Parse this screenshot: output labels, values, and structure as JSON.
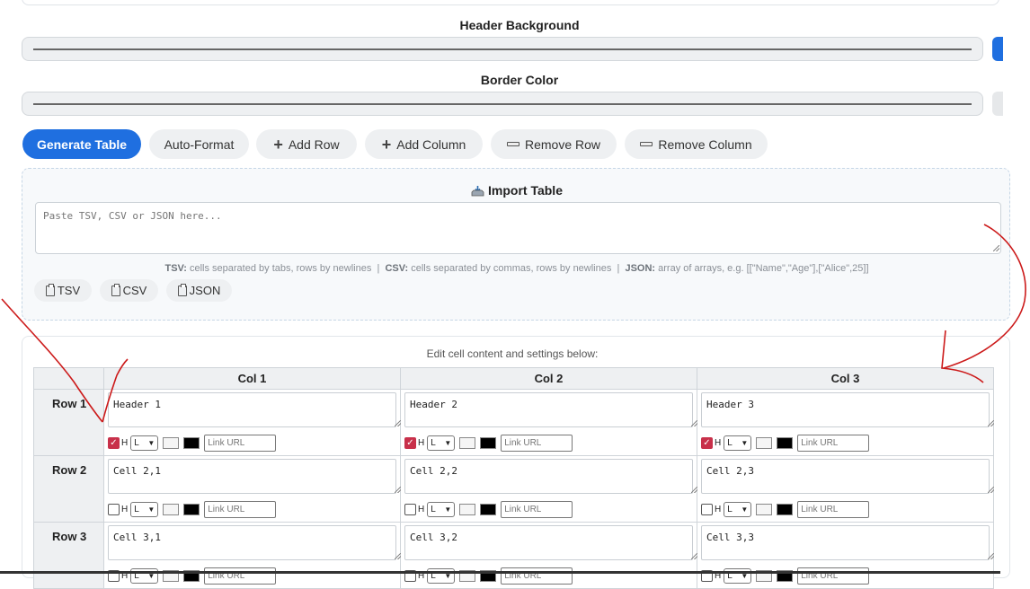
{
  "settings": {
    "header_bg_label": "Header Background",
    "border_color_label": "Border Color",
    "header_bg_value": "#666666",
    "border_color_value": "#666666"
  },
  "toolbar": {
    "generate": "Generate Table",
    "auto_format": "Auto-Format",
    "add_row": "Add Row",
    "add_column": "Add Column",
    "remove_row": "Remove Row",
    "remove_column": "Remove Column"
  },
  "import": {
    "title": "Import Table",
    "placeholder": "Paste TSV, CSV or JSON here...",
    "help_tsv_label": "TSV:",
    "help_tsv": "cells separated by tabs, rows by newlines",
    "help_csv_label": "CSV:",
    "help_csv": "cells separated by commas, rows by newlines",
    "help_json_label": "JSON:",
    "help_json": "array of arrays, e.g. [[\"Name\",\"Age\"],[\"Alice\",25]]",
    "buttons": [
      "TSV",
      "CSV",
      "JSON"
    ]
  },
  "editor": {
    "caption": "Edit cell content and settings below:",
    "columns": [
      "Col 1",
      "Col 2",
      "Col 3"
    ],
    "rows": [
      {
        "label": "Row 1",
        "cells": [
          "Header 1",
          "Header 2",
          "Header 3"
        ],
        "header": true
      },
      {
        "label": "Row 2",
        "cells": [
          "Cell 2,1",
          "Cell 2,2",
          "Cell 2,3"
        ],
        "header": false
      },
      {
        "label": "Row 3",
        "cells": [
          "Cell 3,1",
          "Cell 3,2",
          "Cell 3,3"
        ],
        "header": false
      }
    ],
    "header_toggle_label": "H",
    "align_value": "L",
    "link_placeholder": "Link URL",
    "bg_swatch": "#f5f5f5",
    "text_swatch": "#000000"
  },
  "colors": {
    "primary": "#1f6fe0",
    "checked": "#c8304a",
    "annotation": "#cc1a1a"
  }
}
